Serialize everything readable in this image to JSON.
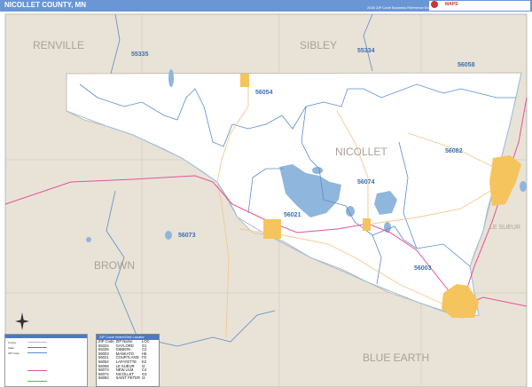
{
  "header": {
    "title": "NICOLLET COUNTY, MN",
    "edition": "2026 ZIP Code Business Reference Edition",
    "logo_text": "MAPS"
  },
  "map": {
    "county_labels": {
      "renville": "RENVILLE",
      "sibley": "SIBLEY",
      "nicollet": "NICOLLET",
      "brown": "BROWN",
      "blue_earth": "BLUE EARTH",
      "le_sueur": "LE SUEUR"
    },
    "zip_labels": {
      "z55335": "55335",
      "z55334": "55334",
      "z56058": "56058",
      "z56054": "56054",
      "z56082": "56082",
      "z56074": "56074",
      "z56021": "56021",
      "z56073": "56073",
      "z56003": "56003"
    },
    "colors": {
      "county_fill": "#ffffff",
      "outside_fill": "#e8e3d6",
      "water": "#8fb6dc",
      "zip_boundary": "#5a8ccc",
      "highway": "#e8509a",
      "road": "#f2c88f",
      "city": "#f5c45c"
    },
    "compass_icon": "compass-rose-icon"
  },
  "legend": {
    "rows": [
      "County",
      "State",
      "ZIP Code"
    ]
  },
  "zip_index": {
    "title": "ZIP Code Index/Grid Locator",
    "columns": [
      "ZIP Code",
      "ZIP Name",
      "LOC"
    ],
    "rows": [
      [
        "55334",
        "GAYLORD",
        "G1"
      ],
      [
        "55335",
        "GIBBON",
        "C2"
      ],
      [
        "56003",
        "MANKATO",
        "H6"
      ],
      [
        "56021",
        "COURTLAND",
        "F5"
      ],
      [
        "56054",
        "LAFAYETTE",
        "E2"
      ],
      [
        "56058",
        "LE SUEUR",
        "I2"
      ],
      [
        "56073",
        "NEW ULM",
        "C4"
      ],
      [
        "56074",
        "NICOLLET",
        "G4"
      ],
      [
        "56082",
        "SAINT PETER",
        "I3"
      ]
    ]
  }
}
